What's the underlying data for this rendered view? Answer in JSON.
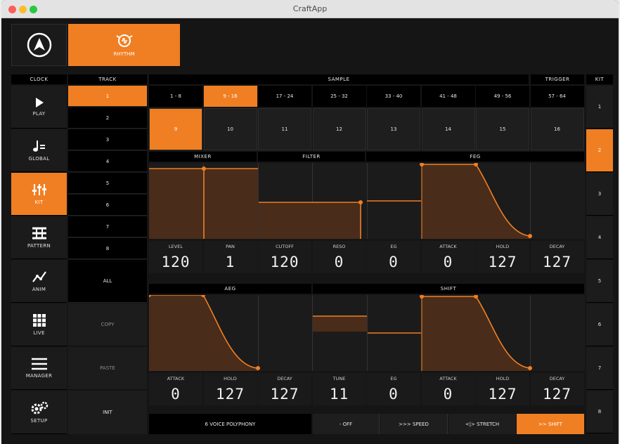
{
  "window": {
    "title": "CraftApp"
  },
  "mode_tab": {
    "label": "RHYTHM"
  },
  "headers": {
    "clock": "CLOCK",
    "track": "TRACK",
    "sample": "SAMPLE",
    "trigger": "TRIGGER",
    "kit": "KIT"
  },
  "nav": [
    {
      "label": "PLAY",
      "icon": "play-icon"
    },
    {
      "label": "GLOBAL",
      "icon": "tempo-icon"
    },
    {
      "label": "KIT",
      "icon": "sliders-icon",
      "active": true
    },
    {
      "label": "PATTERN",
      "icon": "pattern-icon"
    },
    {
      "label": "ANIM",
      "icon": "anim-icon"
    },
    {
      "label": "LIVE",
      "icon": "grid-icon"
    },
    {
      "label": "MANAGER",
      "icon": "menu-icon"
    },
    {
      "label": "SETUP",
      "icon": "gear-icon"
    }
  ],
  "tracks": [
    "1",
    "2",
    "3",
    "4",
    "5",
    "6",
    "7",
    "8"
  ],
  "track_all": "ALL",
  "actions": {
    "copy": "COPY",
    "paste": "PASTE",
    "init": "INIT"
  },
  "banks": [
    "1 - 8",
    "9 - 16",
    "17 - 24",
    "25 - 32",
    "33 - 40",
    "41 - 48",
    "49 - 56",
    "57 - 64"
  ],
  "samples": [
    "9",
    "10",
    "11",
    "12",
    "13",
    "14",
    "15",
    "16"
  ],
  "kits": [
    "1",
    "2",
    "3",
    "4",
    "5",
    "6",
    "7",
    "8"
  ],
  "sections": {
    "mixer": "MIXER",
    "filter": "FILTER",
    "feg": "FEG",
    "aeg": "AEG",
    "shift": "SHIFT"
  },
  "params_top": [
    {
      "label": "LEVEL",
      "value": "120"
    },
    {
      "label": "PAN",
      "value": "1"
    },
    {
      "label": "CUTOFF",
      "value": "120"
    },
    {
      "label": "RESO",
      "value": "0"
    },
    {
      "label": "EG",
      "value": "0"
    },
    {
      "label": "ATTACK",
      "value": "0"
    },
    {
      "label": "HOLD",
      "value": "127"
    },
    {
      "label": "DECAY",
      "value": "127"
    }
  ],
  "params_bottom": [
    {
      "label": "ATTACK",
      "value": "0"
    },
    {
      "label": "HOLD",
      "value": "127"
    },
    {
      "label": "DECAY",
      "value": "127"
    },
    {
      "label": "TUNE",
      "value": "11"
    },
    {
      "label": "EG",
      "value": "0"
    },
    {
      "label": "ATTACK",
      "value": "0"
    },
    {
      "label": "HOLD",
      "value": "127"
    },
    {
      "label": "DECAY",
      "value": "127"
    }
  ],
  "bottom_bar": {
    "polyphony": "6 VOICE POLYPHONY",
    "off": "- OFF",
    "speed": ">>> SPEED",
    "stretch": "<|> STRETCH",
    "shift": ">> SHIFT"
  },
  "colors": {
    "accent": "#f07f23",
    "fill": "#4a2c1a"
  }
}
